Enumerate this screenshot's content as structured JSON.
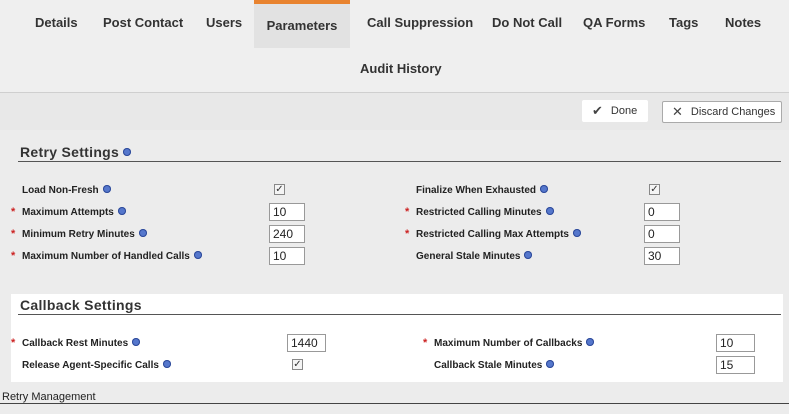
{
  "tabs": [
    {
      "label": "Details"
    },
    {
      "label": "Post Contact"
    },
    {
      "label": "Users"
    },
    {
      "label": "Parameters",
      "active": true
    },
    {
      "label": "Call Suppression"
    },
    {
      "label": "Do Not Call"
    },
    {
      "label": "QA Forms"
    },
    {
      "label": "Tags"
    },
    {
      "label": "Notes"
    }
  ],
  "audit_tab": "Audit History",
  "toolbar": {
    "done_label": "Done",
    "discard_label": "Discard Changes"
  },
  "retry": {
    "title": "Retry Settings",
    "load_non_fresh": {
      "label": "Load Non-Fresh",
      "checked": true
    },
    "max_attempts": {
      "label": "Maximum Attempts",
      "value": "10"
    },
    "min_retry_minutes": {
      "label": "Minimum Retry Minutes",
      "value": "240"
    },
    "max_handled_calls": {
      "label": "Maximum Number of Handled Calls",
      "value": "10"
    },
    "finalize_when_exhausted": {
      "label": "Finalize When Exhausted",
      "checked": true
    },
    "restricted_calling_minutes": {
      "label": "Restricted Calling Minutes",
      "value": "0"
    },
    "restricted_calling_max_attempts": {
      "label": "Restricted Calling Max Attempts",
      "value": "0"
    },
    "general_stale_minutes": {
      "label": "General Stale Minutes",
      "value": "30"
    }
  },
  "callback": {
    "title": "Callback Settings",
    "rest_minutes": {
      "label": "Callback Rest Minutes",
      "value": "1440"
    },
    "release_agent_specific": {
      "label": "Release Agent-Specific Calls",
      "checked": true
    },
    "max_callbacks": {
      "label": "Maximum Number of Callbacks",
      "value": "10"
    },
    "stale_minutes": {
      "label": "Callback Stale Minutes",
      "value": "15"
    }
  },
  "retry_management": "Retry Management",
  "colors": {
    "active_tab_border": "#e8832f",
    "required": "#cc2222",
    "info_icon": "#5577cc"
  }
}
